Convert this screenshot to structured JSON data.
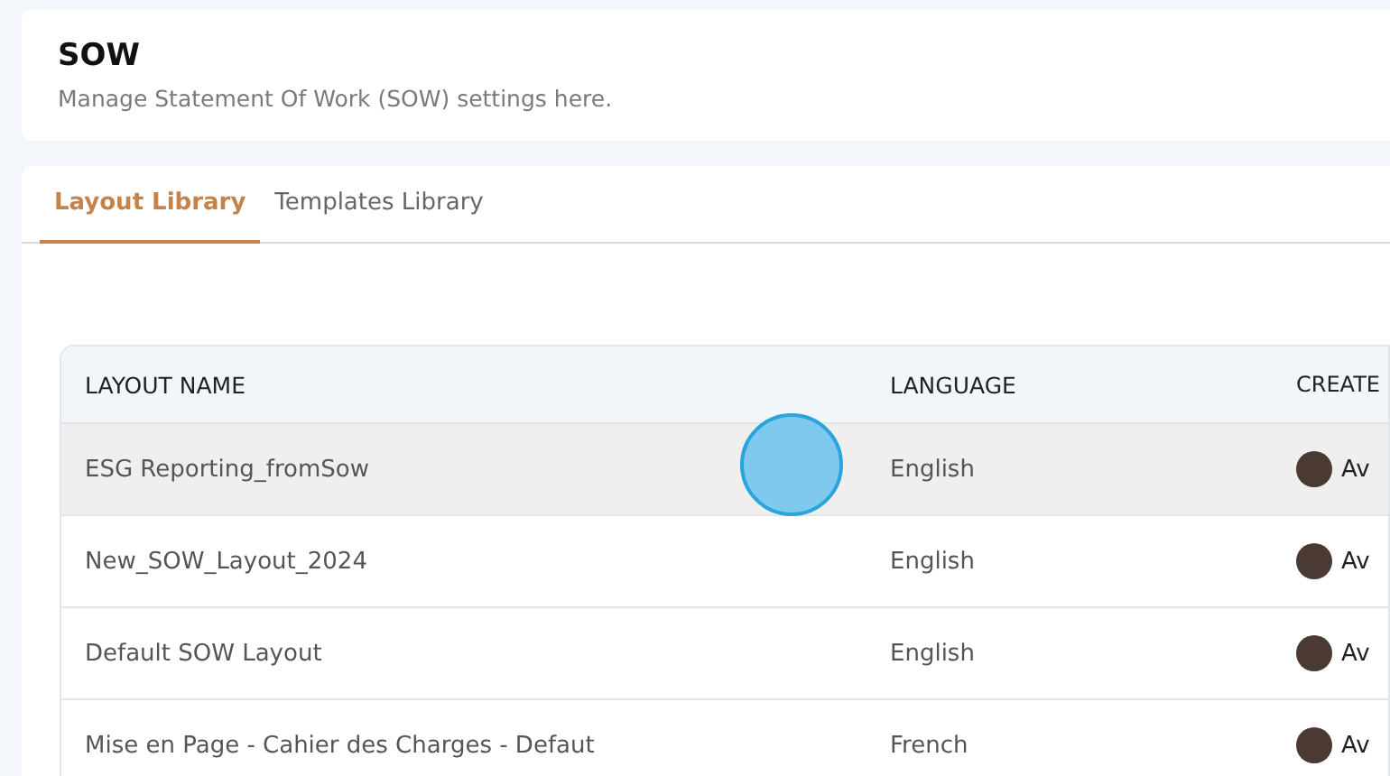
{
  "header": {
    "title": "SOW",
    "subtitle": "Manage Statement Of Work (SOW) settings here."
  },
  "tabs": [
    {
      "label": "Layout Library",
      "selected": true
    },
    {
      "label": "Templates Library",
      "selected": false
    }
  ],
  "table": {
    "columns": [
      "LAYOUT NAME",
      "LANGUAGE",
      "CREATE"
    ],
    "rows": [
      {
        "cells": [
          "ESG Reporting_fromSow",
          "English",
          "Av"
        ],
        "hovered": true
      },
      {
        "cells": [
          "New_SOW_Layout_2024",
          "English",
          "Av"
        ],
        "hovered": false
      },
      {
        "cells": [
          "Default SOW Layout",
          "English",
          "Av"
        ],
        "hovered": false
      },
      {
        "cells": [
          "Mise en Page - Cahier des Charges - Defaut",
          "French",
          "Av"
        ],
        "hovered": false
      }
    ]
  }
}
